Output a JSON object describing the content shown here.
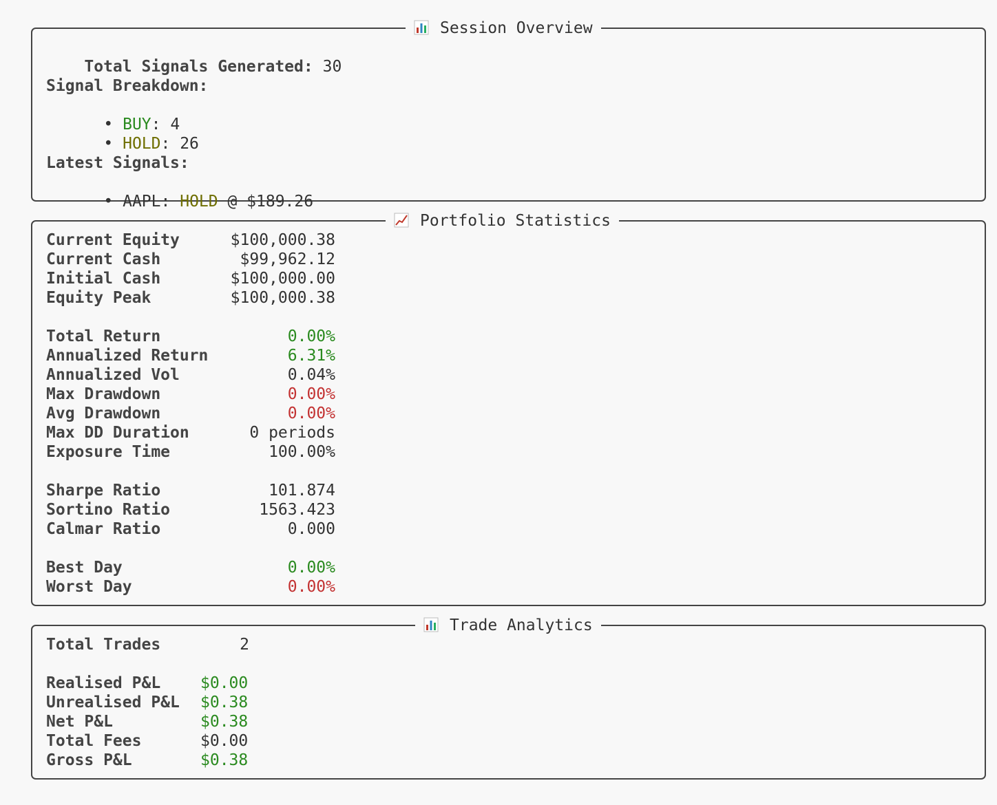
{
  "session_overview": {
    "title": "Session Overview",
    "icon": "bar-chart-icon",
    "total_signals_label": "Total Signals Generated:",
    "total_signals_value": "30",
    "breakdown_heading": "Signal Breakdown:",
    "breakdown": [
      {
        "bullet": "•",
        "signal": "BUY",
        "count": "4",
        "color": "#2a8a1f"
      },
      {
        "bullet": "•",
        "signal": "HOLD",
        "count": "26",
        "color": "#6e6e00"
      }
    ],
    "latest_heading": "Latest Signals:",
    "latest": [
      {
        "bullet": "•",
        "symbol": "AAPL:",
        "signal": "HOLD",
        "price": "@ $189.26"
      }
    ]
  },
  "portfolio_statistics": {
    "title": "Portfolio Statistics",
    "icon": "line-chart-icon",
    "rows": [
      {
        "label": "Current Equity",
        "value": "$100,000.38",
        "tone": "neutral"
      },
      {
        "label": "Current Cash",
        "value": "$99,962.12",
        "tone": "neutral"
      },
      {
        "label": "Initial Cash",
        "value": "$100,000.00",
        "tone": "neutral"
      },
      {
        "label": "Equity Peak",
        "value": "$100,000.38",
        "tone": "neutral"
      },
      {
        "label": "Total Return",
        "value": "0.00%",
        "tone": "positive"
      },
      {
        "label": "Annualized Return",
        "value": "6.31%",
        "tone": "positive"
      },
      {
        "label": "Annualized Vol",
        "value": "0.04%",
        "tone": "neutral"
      },
      {
        "label": "Max Drawdown",
        "value": "0.00%",
        "tone": "negative"
      },
      {
        "label": "Avg Drawdown",
        "value": "0.00%",
        "tone": "negative"
      },
      {
        "label": "Max DD Duration",
        "value": "0 periods",
        "tone": "neutral"
      },
      {
        "label": "Exposure Time",
        "value": "100.00%",
        "tone": "neutral"
      },
      {
        "label": "Sharpe Ratio",
        "value": "101.874",
        "tone": "neutral"
      },
      {
        "label": "Sortino Ratio",
        "value": "1563.423",
        "tone": "neutral"
      },
      {
        "label": "Calmar Ratio",
        "value": "0.000",
        "tone": "neutral"
      },
      {
        "label": "Best Day",
        "value": "0.00%",
        "tone": "positive"
      },
      {
        "label": "Worst Day",
        "value": "0.00%",
        "tone": "negative"
      }
    ]
  },
  "trade_analytics": {
    "title": "Trade Analytics",
    "icon": "bar-chart-icon",
    "total_trades_label": "Total Trades",
    "total_trades_value": "2",
    "rows": [
      {
        "label": "Realised P&L",
        "value": "$0.00",
        "tone": "positive"
      },
      {
        "label": "Unrealised P&L",
        "value": "$0.38",
        "tone": "positive"
      },
      {
        "label": "Net P&L",
        "value": "$0.38",
        "tone": "positive"
      },
      {
        "label": "Total Fees",
        "value": "$0.00",
        "tone": "neutral"
      },
      {
        "label": "Gross P&L",
        "value": "$0.38",
        "tone": "positive"
      }
    ]
  },
  "colors": {
    "positive": "#2a8a1f",
    "negative": "#c33232",
    "hold": "#6e6e00",
    "neutral": "#333333"
  }
}
